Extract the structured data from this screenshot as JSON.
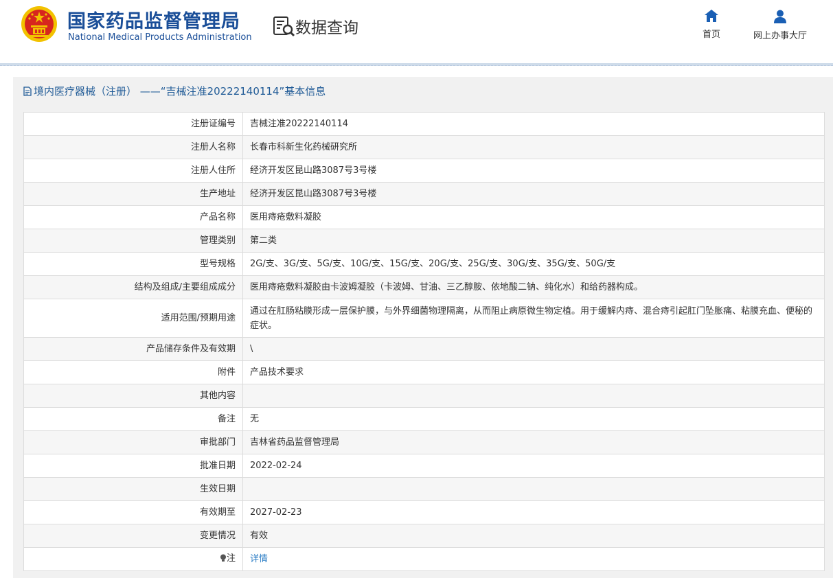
{
  "header": {
    "org_name_cn": "国家药品监督管理局",
    "org_name_en": "National Medical Products Administration",
    "section": "数据查询",
    "nav": [
      {
        "label": "首页",
        "icon": "home-icon"
      },
      {
        "label": "网上办事大厅",
        "icon": "user-icon"
      }
    ]
  },
  "panel": {
    "title": "境内医疗器械（注册） ——“吉械注准20222140114”基本信息"
  },
  "rows": [
    {
      "label": "注册证编号",
      "value": "吉械注准20222140114"
    },
    {
      "label": "注册人名称",
      "value": "长春市科新生化药械研究所"
    },
    {
      "label": "注册人住所",
      "value": "经济开发区昆山路3087号3号楼"
    },
    {
      "label": "生产地址",
      "value": "经济开发区昆山路3087号3号楼"
    },
    {
      "label": "产品名称",
      "value": "医用痔疮敷料凝胶"
    },
    {
      "label": "管理类别",
      "value": "第二类"
    },
    {
      "label": "型号规格",
      "value": "2G/支、3G/支、5G/支、10G/支、15G/支、20G/支、25G/支、30G/支、35G/支、50G/支"
    },
    {
      "label": "结构及组成/主要组成成分",
      "value": "医用痔疮敷料凝胶由卡波姆凝胶（卡波姆、甘油、三乙醇胺、依地酸二钠、纯化水）和给药器构成。"
    },
    {
      "label": "适用范围/预期用途",
      "value": "通过在肛肠粘膜形成一层保护膜，与外界细菌物理隔离，从而阻止病原微生物定植。用于缓解内痔、混合痔引起肛门坠胀痛、粘膜充血、便秘的症状。"
    },
    {
      "label": "产品储存条件及有效期",
      "value": "\\"
    },
    {
      "label": "附件",
      "value": "产品技术要求"
    },
    {
      "label": "其他内容",
      "value": ""
    },
    {
      "label": "备注",
      "value": "无"
    },
    {
      "label": "审批部门",
      "value": "吉林省药品监督管理局"
    },
    {
      "label": "批准日期",
      "value": "2022-02-24"
    },
    {
      "label": "生效日期",
      "value": ""
    },
    {
      "label": "有效期至",
      "value": "2027-02-23"
    },
    {
      "label": "变更情况",
      "value": "有效"
    },
    {
      "label": "注",
      "value": "详情",
      "icon": "info-bulb-icon"
    }
  ],
  "colors": {
    "brand": "#1a4e98",
    "link": "#2f7fc6",
    "emblem_red": "#d7261e",
    "emblem_gold": "#f2c200"
  }
}
